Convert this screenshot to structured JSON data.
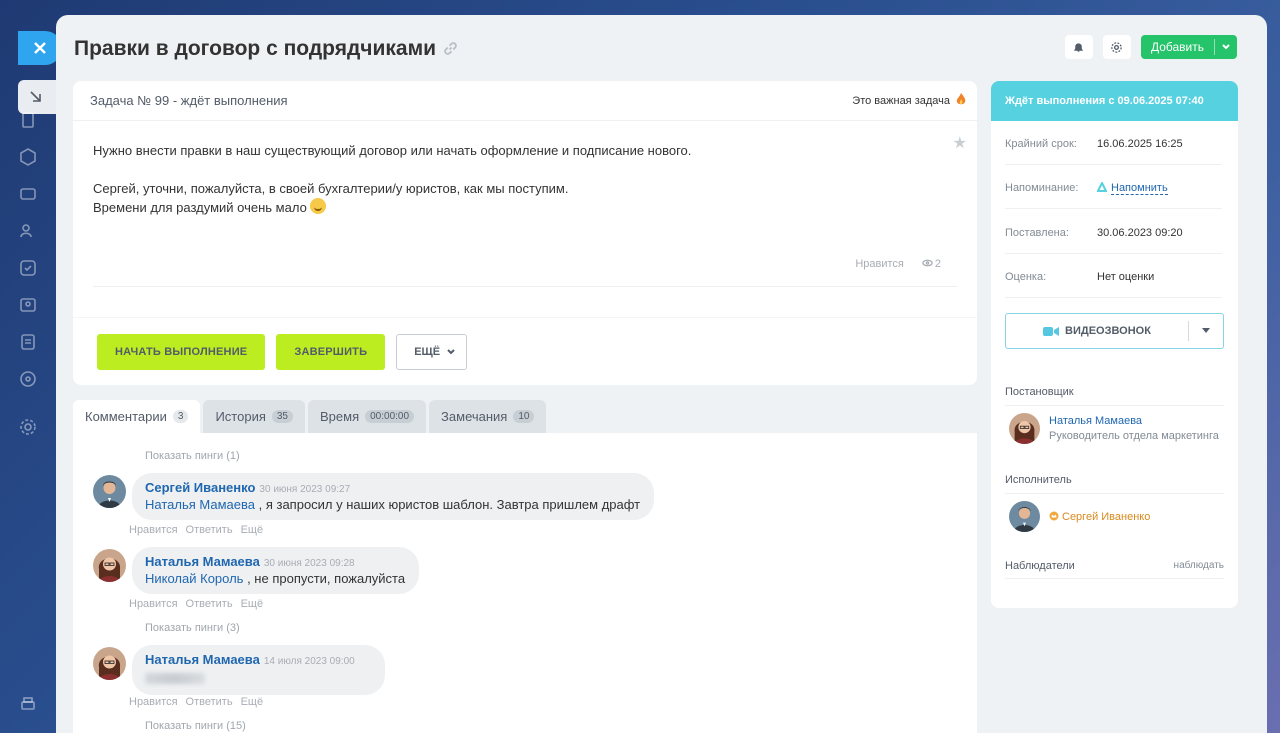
{
  "task": {
    "title": "Правки в договор с подрядчиками",
    "header_label": "Задача № 99 - ждёт выполнения",
    "important_label": "Это важная задача",
    "description": [
      "Нужно внести правки в наш существующий договор или начать оформление и подписание нового.",
      "Сергей, уточни, пожалуйста, в своей бухгалтерии/у юристов, как мы поступим.",
      "Времени для раздумий очень мало"
    ],
    "like_label": "Нравится",
    "views_count": "2",
    "buttons": {
      "start": "НАЧАТЬ ВЫПОЛНЕНИЕ",
      "complete": "ЗАВЕРШИТЬ",
      "more": "ЕЩЁ"
    }
  },
  "top_actions": {
    "add_label": "Добавить"
  },
  "tabs": [
    {
      "label": "Комментарии",
      "count": "3",
      "active": true
    },
    {
      "label": "История",
      "count": "35"
    },
    {
      "label": "Время",
      "count": "00:00:00"
    },
    {
      "label": "Замечания",
      "count": "10"
    }
  ],
  "comments": {
    "show_pings_top": "Показать пинги (1)",
    "show_pings_mid": "Показать пинги (3)",
    "show_pings_bottom": "Показать пинги (15)",
    "actions": {
      "like": "Нравится",
      "reply": "Ответить",
      "more": "Ещё"
    },
    "items": [
      {
        "author": "Сергей Иваненко",
        "date": "30 июня 2023 09:27",
        "mention": "Наталья Мамаева",
        "text": ", я запросил у наших юристов шаблон. Завтра пришлем драфт"
      },
      {
        "author": "Наталья Мамаева",
        "date": "30 июня 2023 09:28",
        "mention": "Николай Король",
        "text": ", не пропусти, пожалуйста"
      },
      {
        "author": "Наталья Мамаева",
        "date": "14 июля 2023 09:00"
      }
    ]
  },
  "sidebar": {
    "status": "Ждёт выполнения с 09.06.2025 07:40",
    "deadline_label": "Крайний срок:",
    "deadline_value": "16.06.2025 16:25",
    "reminder_label": "Напоминание:",
    "reminder_value": "Напомнить",
    "created_label": "Поставлена:",
    "created_value": "30.06.2023 09:20",
    "rating_label": "Оценка:",
    "rating_value": "Нет оценки",
    "video_call": "ВИДЕОЗВОНОК",
    "creator_title": "Постановщик",
    "creator_name": "Наталья Мамаева",
    "creator_position": "Руководитель отдела маркетинга",
    "assignee_title": "Исполнитель",
    "assignee_name": "Сергей Иваненко",
    "watchers_title": "Наблюдатели",
    "watch_link": "наблюдать"
  },
  "colors": {
    "accent_green": "#bbed21",
    "status_header": "#56d1e0",
    "link_blue": "#2067b0",
    "add_button": "#25c46a"
  }
}
